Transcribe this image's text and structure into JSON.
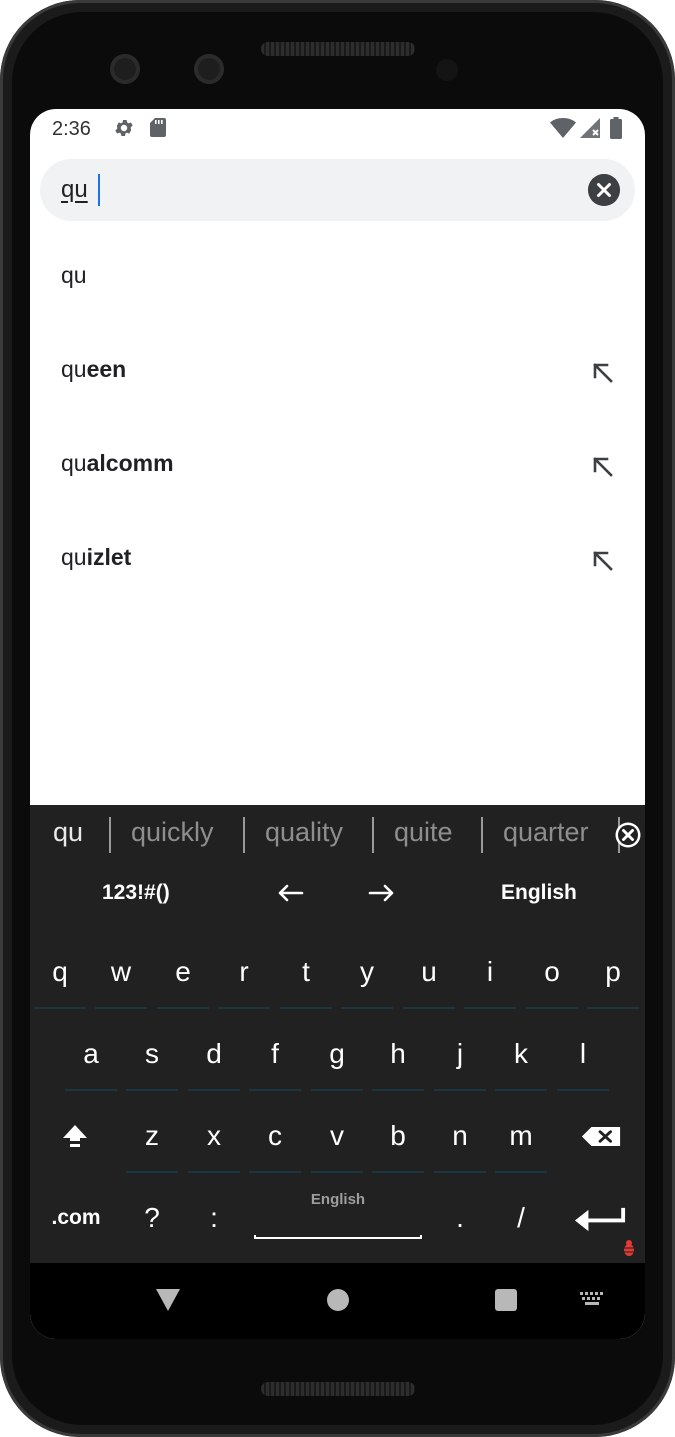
{
  "status_bar": {
    "time": "2:36",
    "icons": [
      "settings-gear-icon",
      "sd-card-icon",
      "wifi-icon",
      "cell-signal-icon",
      "battery-icon"
    ]
  },
  "search": {
    "query": "qu",
    "clear_icon": "close-circle-icon"
  },
  "suggestions": [
    {
      "prefix": "qu",
      "rest": "",
      "arrow": false
    },
    {
      "prefix": "qu",
      "rest": "een",
      "arrow": true
    },
    {
      "prefix": "qu",
      "rest": "alcomm",
      "arrow": true
    },
    {
      "prefix": "qu",
      "rest": "izlet",
      "arrow": true
    }
  ],
  "keyboard": {
    "candidates": [
      "qu",
      "quickly",
      "quality",
      "quite",
      "quarter"
    ],
    "toolbar": {
      "symbols": "123!#()",
      "left_arrow": "←",
      "right_arrow": "→",
      "language": "English"
    },
    "row1": [
      "q",
      "w",
      "e",
      "r",
      "t",
      "y",
      "u",
      "i",
      "o",
      "p"
    ],
    "row2": [
      "a",
      "s",
      "d",
      "f",
      "g",
      "h",
      "j",
      "k",
      "l"
    ],
    "row3": [
      "z",
      "x",
      "c",
      "v",
      "b",
      "n",
      "m"
    ],
    "bottom": {
      "dotcom": ".com",
      "question": "?",
      "colon": ":",
      "space_label": "English",
      "period": ".",
      "slash": "/"
    }
  },
  "colors": {
    "accent": "#1a73e8",
    "keyboard_bg": "#212121",
    "search_bg": "#f1f2f4"
  }
}
